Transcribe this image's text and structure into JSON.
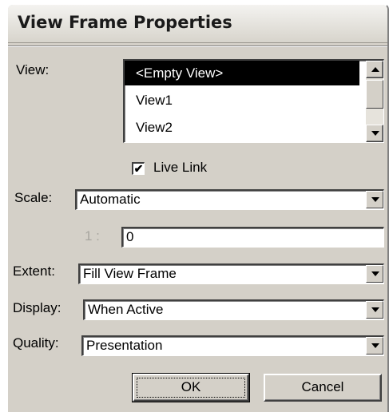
{
  "dialog": {
    "title": "View Frame Properties"
  },
  "view": {
    "label": "View:",
    "items": [
      "<Empty View>",
      "View1",
      "View2"
    ],
    "selected_index": 0
  },
  "live_link": {
    "label": "Live Link",
    "checked": true,
    "check_glyph": "✔"
  },
  "scale": {
    "label": "Scale:",
    "value": "Automatic"
  },
  "ratio": {
    "label": "1 :",
    "value": "0"
  },
  "extent": {
    "label": "Extent:",
    "value": "Fill View Frame"
  },
  "display": {
    "label": "Display:",
    "value": "When Active"
  },
  "quality": {
    "label": "Quality:",
    "value": "Presentation"
  },
  "buttons": {
    "ok": "OK",
    "cancel": "Cancel"
  },
  "colors": {
    "dialog_bg": "#d4d0c8",
    "selection_bg": "#000000",
    "disabled_text": "#a8a6a0"
  }
}
